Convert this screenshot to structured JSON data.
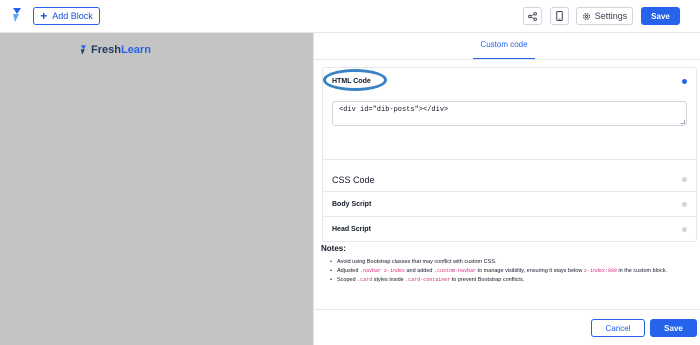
{
  "header": {
    "add_block_label": "Add Block",
    "settings_label": "Settings",
    "save_label": "Save"
  },
  "canvas": {
    "brand_part1": "Fresh",
    "brand_part2": "Learn"
  },
  "panel": {
    "tab_label": "Custom code",
    "sections": [
      {
        "label": "HTML Code",
        "active": true
      },
      {
        "label": "CSS Code",
        "active": false
      },
      {
        "label": "Body Script",
        "active": false
      },
      {
        "label": "Head Script",
        "active": false
      }
    ],
    "html_code_value": "<div id=\"dib-posts\"></div>",
    "notes_title": "Notes:",
    "notes": [
      {
        "parts": [
          "Avoid using Bootstrap classes that may conflict with custom CSS."
        ]
      },
      {
        "parts": [
          "Adjusted ",
          ".navbar z-index",
          " and added ",
          ".custom-navbar",
          " to manage visibility, ensuring it stays below ",
          "z-index:999",
          " in the custom block."
        ]
      },
      {
        "parts": [
          "Scoped ",
          ".card",
          " styles inside ",
          ".card-container",
          " to prevent Bootstrap conflicts."
        ]
      }
    ],
    "cancel_label": "Cancel",
    "save_label": "Save"
  },
  "colors": {
    "accent": "#2563eb",
    "canvas_bg": "#c4c4c4",
    "highlight_ring": "#3b82c4"
  },
  "icons": [
    "freshlearn-logo-icon",
    "plus-icon",
    "share-icon",
    "mobile-icon",
    "gear-icon"
  ]
}
